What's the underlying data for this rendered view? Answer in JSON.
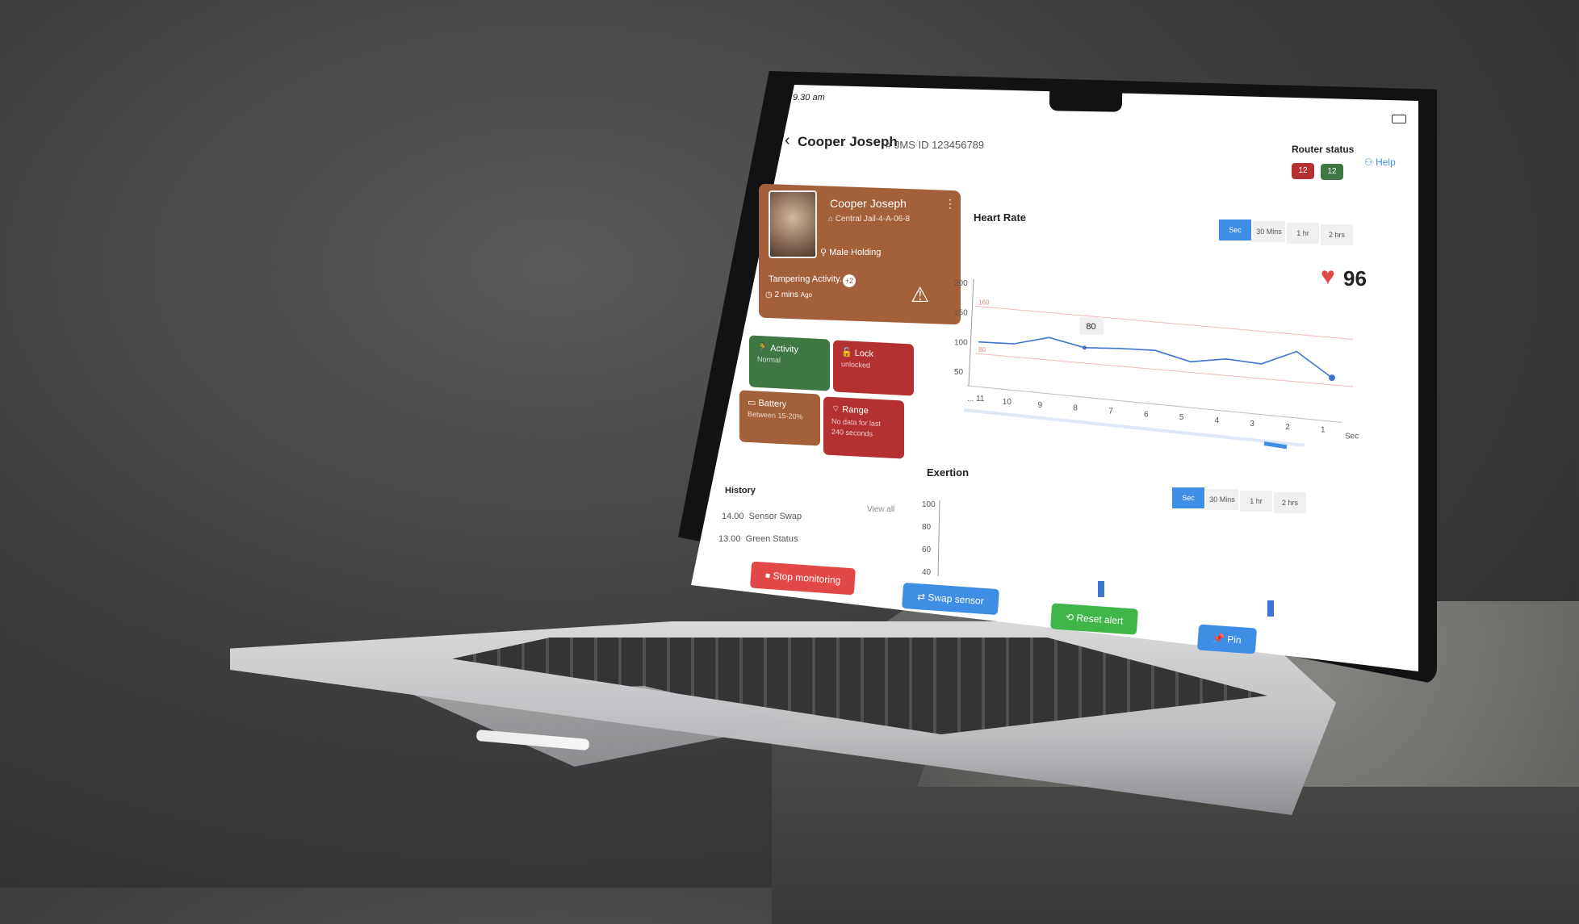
{
  "status_bar": {
    "time": "9.30 am"
  },
  "header": {
    "back_icon": "chevron-left-icon",
    "title": "Cooper Joseph",
    "jms_id": "# JMS ID 123456789",
    "router_status_label": "Router status",
    "router_red": "12",
    "router_green": "12",
    "help": "Help"
  },
  "profile": {
    "name": "Cooper Joseph",
    "location": "Central Jail-4-A-06-8",
    "holding": "Male Holding",
    "tampering": "Tampering Activity..",
    "tampering_count": "+2",
    "ago_value": "2 mins",
    "ago_unit": "Ago"
  },
  "tiles": {
    "activity": {
      "title": "Activity",
      "sub": "Normal"
    },
    "lock": {
      "title": "Lock",
      "sub": "unlocked"
    },
    "battery": {
      "title": "Battery",
      "sub": "Between 15-20%"
    },
    "range": {
      "title": "Range",
      "sub1": "No data for last",
      "sub2": "240 seconds"
    }
  },
  "history": {
    "title": "History",
    "view_all": "View all",
    "items": [
      {
        "time": "14.00",
        "label": "Sensor Swap"
      },
      {
        "time": "13.00",
        "label": "Green Status"
      }
    ]
  },
  "heart_rate": {
    "title": "Heart Rate",
    "segments": [
      "Sec",
      "30 Mins",
      "1 hr",
      "2 hrs"
    ],
    "bpm": "96",
    "tooltip": "80"
  },
  "exertion": {
    "title": "Exertion",
    "segments": [
      "Sec",
      "30 Mins",
      "1 hr",
      "2 hrs"
    ]
  },
  "chart_data": [
    {
      "type": "line",
      "title": "Heart Rate",
      "x": [
        "... 11",
        "10",
        "9",
        "8",
        "7",
        "6",
        "5",
        "4",
        "3",
        "2",
        "1"
      ],
      "xlabel": "Sec",
      "yticks": [
        "200",
        "150",
        "100",
        "50"
      ],
      "ylim": [
        50,
        200
      ],
      "upper_threshold": "160",
      "lower_threshold": "80",
      "series": [
        {
          "values": [
            100,
            102,
            118,
            106,
            110,
            112,
            98,
            108,
            105,
            131,
            92
          ]
        }
      ]
    },
    {
      "type": "bar",
      "title": "Exertion",
      "yticks": [
        "100",
        "80",
        "60",
        "40"
      ],
      "ylim": [
        40,
        100
      ]
    }
  ],
  "actions": {
    "stop": "Stop monitoring",
    "swap": "Swap sensor",
    "reset": "Reset alert",
    "pin": "Pin"
  },
  "colors": {
    "accent": "#3f8ee6",
    "danger": "#e34848",
    "success": "#3fb54a",
    "brown": "#a3603b",
    "green": "#3f7843",
    "red": "#b53131"
  }
}
